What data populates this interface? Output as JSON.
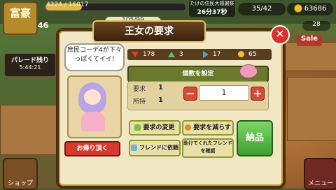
{
  "hud": {
    "rank_label": "富豪",
    "level": "46",
    "xp_text": "4224 / 16017",
    "xp_progress": 0.26,
    "population": "105/99",
    "event_line": "たけの住民大感謝祭",
    "event_time": "26分37秒",
    "storage": "35/42",
    "coins": "63686",
    "right_value": "28"
  },
  "side": {
    "parade_label": "パレード残り",
    "parade_time": "5:44:21",
    "shop_label": "ショップ",
    "menu_label": "メニュー",
    "sale_label": "Sale"
  },
  "dialog": {
    "title": "王女の要求",
    "speech": "庶民コーデ4が下々っぽくてイイ!",
    "back_button": "お帰り頂く",
    "resources": [
      {
        "icon": "red-gem-icon",
        "value": "178"
      },
      {
        "icon": "green-gem-icon",
        "value": "3"
      },
      {
        "icon": "blue-arrow-icon",
        "value": "17"
      },
      {
        "icon": "gold-coin-icon",
        "value": "65"
      }
    ],
    "item_label": "個数を設定",
    "request_label": "要求",
    "request_value": "1",
    "owned_label": "所持",
    "owned_value": "1",
    "quantity": "1",
    "change_button": "要求の変更",
    "reduce_button": "要求を減らす",
    "ask_friend_button": "フレンドに依頼",
    "confirm_friend_button": "助けてくれたフレンドを確認",
    "deliver_button": "納品"
  },
  "colors": {
    "dialog_bg": "#f1e7c4",
    "deliver": "#3d9f2c",
    "back": "#d63a2f"
  }
}
